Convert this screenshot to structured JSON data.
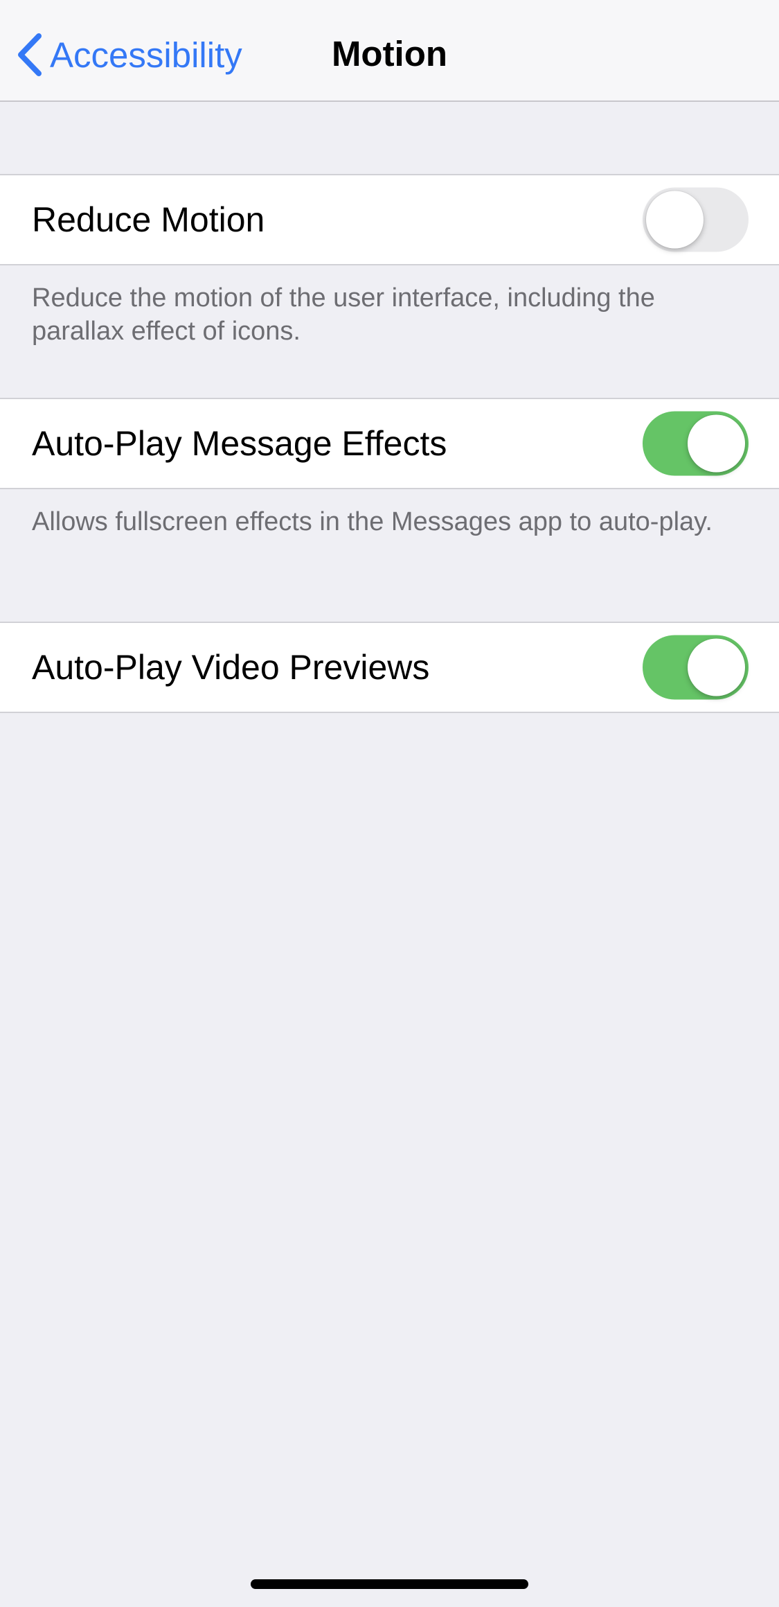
{
  "navbar": {
    "back_label": "Accessibility",
    "title": "Motion"
  },
  "settings": [
    {
      "label": "Reduce Motion",
      "toggle": "off",
      "footer": "Reduce the motion of the user interface, including the parallax effect of icons."
    },
    {
      "label": "Auto-Play Message Effects",
      "toggle": "on",
      "footer": "Allows fullscreen effects in the Messages app to auto-play."
    },
    {
      "label": "Auto-Play Video Previews",
      "toggle": "on"
    }
  ],
  "colors": {
    "accent": "#3478f6",
    "toggle_on": "#65c466",
    "toggle_off": "#e9e9eb",
    "background": "#efeff4"
  }
}
